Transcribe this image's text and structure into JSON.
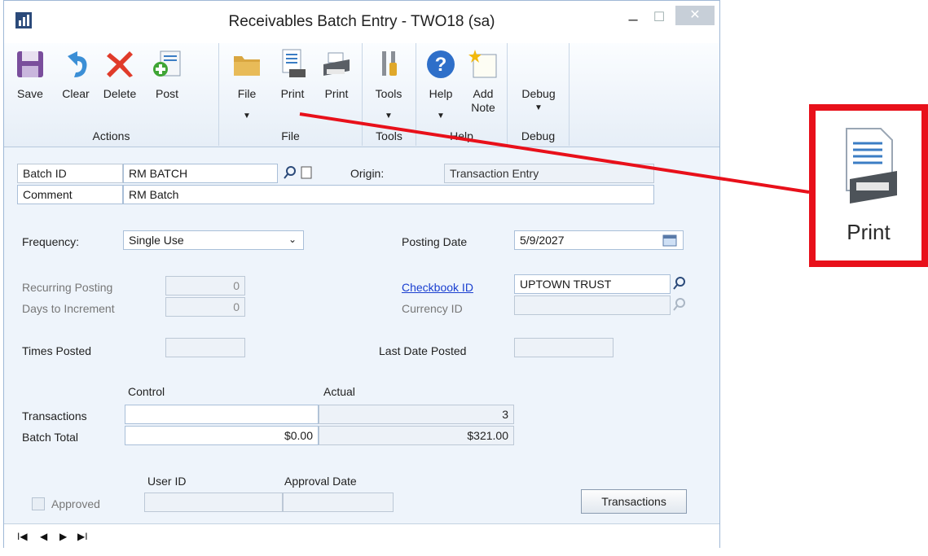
{
  "window": {
    "title": "Receivables Batch Entry  -  TWO18 (sa)"
  },
  "ribbon": {
    "groups": {
      "actions": "Actions",
      "file": "File",
      "tools": "Tools",
      "help": "Help",
      "debug": "Debug"
    },
    "buttons": {
      "save": "Save",
      "clear": "Clear",
      "delete": "Delete",
      "post": "Post",
      "file": "File",
      "print_preview": "Print",
      "print": "Print",
      "tools": "Tools",
      "help": "Help",
      "add_note_1": "Add",
      "add_note_2": "Note",
      "debug": "Debug"
    }
  },
  "form": {
    "batch_id": {
      "label": "Batch ID",
      "value": "RM BATCH"
    },
    "origin": {
      "label": "Origin:",
      "value": "Transaction Entry"
    },
    "comment": {
      "label": "Comment",
      "value": "RM Batch"
    },
    "frequency": {
      "label": "Frequency:",
      "value": "Single Use"
    },
    "posting_date": {
      "label": "Posting Date",
      "value": "5/9/2027"
    },
    "recurring_posting": {
      "label": "Recurring Posting",
      "value": "0"
    },
    "days_to_increment": {
      "label": "Days to Increment",
      "value": "0"
    },
    "checkbook_id": {
      "label": "Checkbook ID",
      "value": "UPTOWN TRUST"
    },
    "currency_id": {
      "label": "Currency ID",
      "value": ""
    },
    "times_posted": {
      "label": "Times Posted",
      "value": ""
    },
    "last_date_posted": {
      "label": "Last Date Posted",
      "value": ""
    },
    "totals": {
      "control_header": "Control",
      "actual_header": "Actual",
      "transactions_label": "Transactions",
      "batch_total_label": "Batch Total",
      "transactions_control": "",
      "transactions_actual": "3",
      "batch_total_control": "$0.00",
      "batch_total_actual": "$321.00"
    },
    "approval": {
      "user_id_label": "User ID",
      "approval_date_label": "Approval Date",
      "approved_label": "Approved"
    },
    "transactions_button": "Transactions"
  },
  "navigation": {
    "first": "I◀",
    "prev": "◀",
    "next": "▶",
    "last": "▶I"
  },
  "callout": {
    "label": "Print"
  },
  "colors": {
    "accent": "#e8101a",
    "link": "#1a3fd0",
    "window_bg": "#eef4fb"
  },
  "icons": [
    "save-icon",
    "clear-icon",
    "delete-icon",
    "post-icon",
    "folder-icon",
    "print-preview-icon",
    "printer-icon",
    "tools-icon",
    "help-icon",
    "add-note-icon",
    "lookup-icon",
    "new-icon",
    "calendar-icon"
  ]
}
